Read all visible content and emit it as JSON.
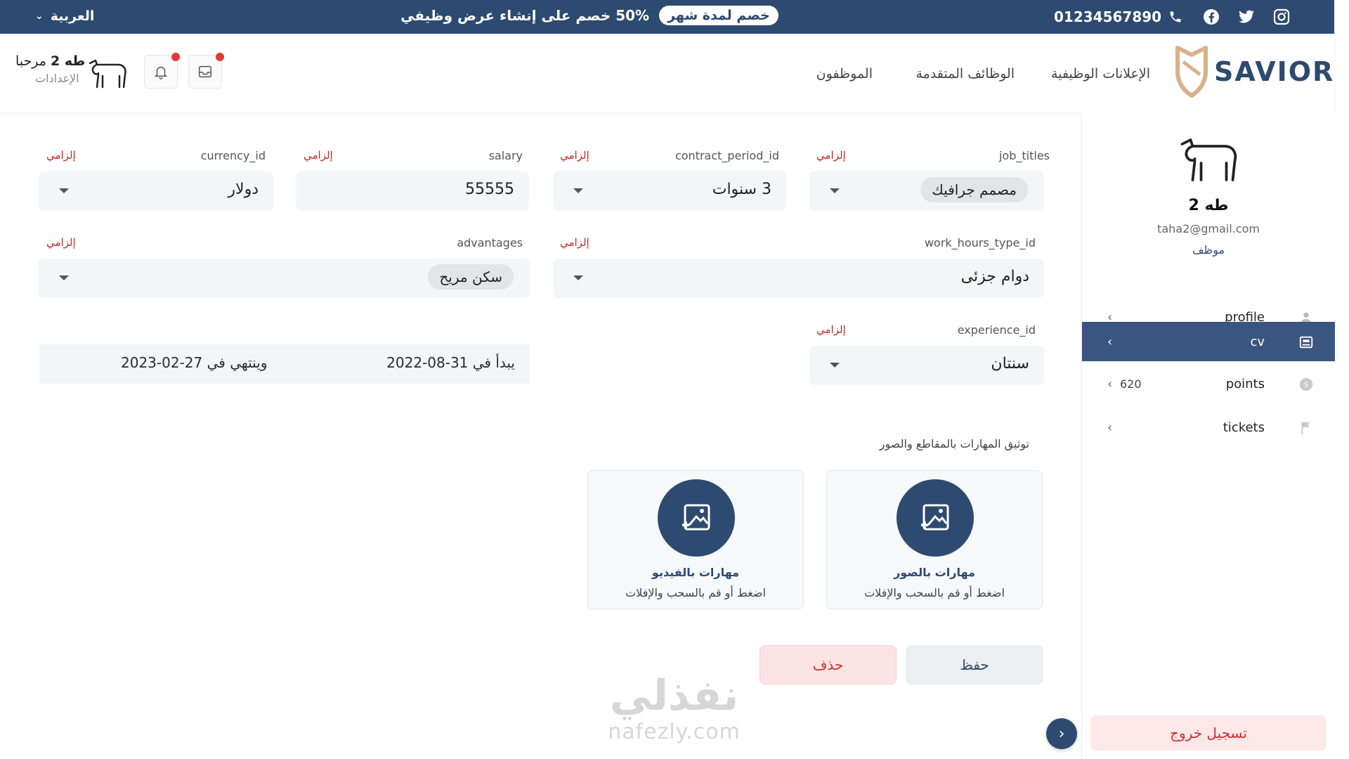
{
  "topbar": {
    "language": "العربية",
    "promo_text": "50% خصم على إنشاء عرض وظيفي",
    "promo_badge": "خصم لمدة شهر",
    "phone": "01234567890"
  },
  "header": {
    "logo_text": "SAVIOR",
    "nav": [
      "الإعلانات الوظيفية",
      "الوظائف المتقدمة",
      "الموظفون"
    ],
    "greeting": "مرحبا",
    "user_name": "طه 2",
    "settings": "الإعدادات"
  },
  "sidebar": {
    "name": "طه 2",
    "email": "taha2@gmail.com",
    "role": "موظف",
    "items": [
      {
        "label": "profile",
        "icon": "user-icon"
      },
      {
        "label": "cv",
        "icon": "cv-icon",
        "active": true
      },
      {
        "label": "points",
        "icon": "coin-icon",
        "extra": "620"
      },
      {
        "label": "tickets",
        "icon": "flag-icon"
      }
    ],
    "logout": "تسجيل خروج"
  },
  "form": {
    "required": "إلزامي",
    "job_titles": {
      "label": "job_titles",
      "value": "مصمم جرافيك"
    },
    "contract_period": {
      "label": "contract_period_id",
      "value": "3 سنوات"
    },
    "salary": {
      "label": "salary",
      "value": "55555"
    },
    "currency": {
      "label": "currency_id",
      "value": "دولار"
    },
    "work_hours": {
      "label": "work_hours_type_id",
      "value": "دوام جزئى"
    },
    "advantages": {
      "label": "advantages",
      "value": "سكن مريح"
    },
    "experience": {
      "label": "experience_id",
      "value": "سنتان"
    },
    "dates": {
      "start": "يبدأ في 31-08-2022",
      "end": "وينتهي في 27-02-2023"
    },
    "skills_section": "توثيق المهارات بالمقاطع والصور",
    "upload_images": {
      "title": "مهارات بالصور",
      "hint": "اضغط أو قم بالسحب والإفلات"
    },
    "upload_video": {
      "title": "مهارات بالفيديو",
      "hint": "اضغط أو قم بالسحب والإفلات"
    },
    "save": "حفظ",
    "delete": "حذف"
  },
  "watermark": {
    "ar": "نفذلي",
    "en": "nafezly.com"
  },
  "colors": {
    "primary": "#2d4a70",
    "danger": "#d32f2f",
    "required": "#c62828"
  }
}
